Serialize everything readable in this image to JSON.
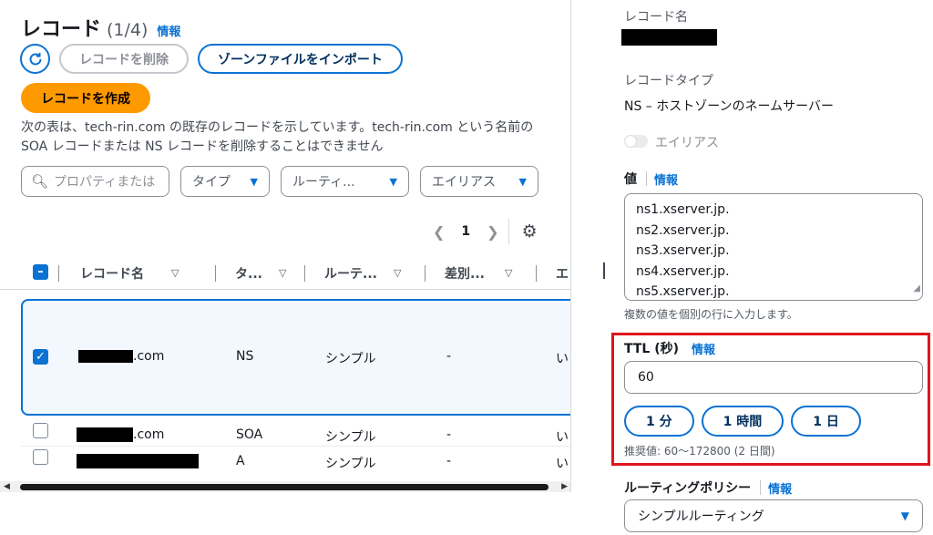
{
  "left": {
    "title": "レコード",
    "count": "(1/4)",
    "info": "情報",
    "delete_label": "レコードを削除",
    "import_label": "ゾーンファイルをインポート",
    "create_label": "レコードを作成",
    "description": "次の表は、tech-rin.com の既存のレコードを示しています。tech-rin.com という名前の SOA レコードまたは NS レコードを削除することはできません",
    "search_placeholder": "プロパティまたは",
    "filters": [
      "タイプ",
      "ルーティ...",
      "エイリアス"
    ],
    "page": "1",
    "columns": [
      "レコード名",
      "タ...",
      "ルーテ...",
      "差別...",
      "エ"
    ],
    "rows": [
      {
        "name_suffix": ".com",
        "type": "NS",
        "routing": "シンプル",
        "diff": "-",
        "alias": "い",
        "selected": true
      },
      {
        "name_suffix": ".com",
        "type": "SOA",
        "routing": "シンプル",
        "diff": "-",
        "alias": "い",
        "selected": false
      },
      {
        "name_suffix": "",
        "type": "A",
        "routing": "シンプル",
        "diff": "-",
        "alias": "い",
        "selected": false
      }
    ]
  },
  "right": {
    "record_name_label": "レコード名",
    "record_type_label": "レコードタイプ",
    "record_type_value": "NS – ホストゾーンのネームサーバー",
    "alias_label": "エイリアス",
    "value_label": "値",
    "info": "情報",
    "values": [
      "ns1.xserver.jp.",
      "ns2.xserver.jp.",
      "ns3.xserver.jp.",
      "ns4.xserver.jp.",
      "ns5.xserver.jp."
    ],
    "value_hint": "複数の値を個別の行に入力します。",
    "ttl_label": "TTL (秒)",
    "ttl_value": "60",
    "ttl_buttons": [
      "1 分",
      "1 時間",
      "1 日"
    ],
    "ttl_hint": "推奨値: 60～172800 (2 日間)",
    "routing_label": "ルーティングポリシー",
    "routing_value": "シンプルルーティング"
  },
  "colors": {
    "accent": "#0972d3",
    "primary_button": "#ff9900",
    "highlight_box": "#e0151b"
  }
}
